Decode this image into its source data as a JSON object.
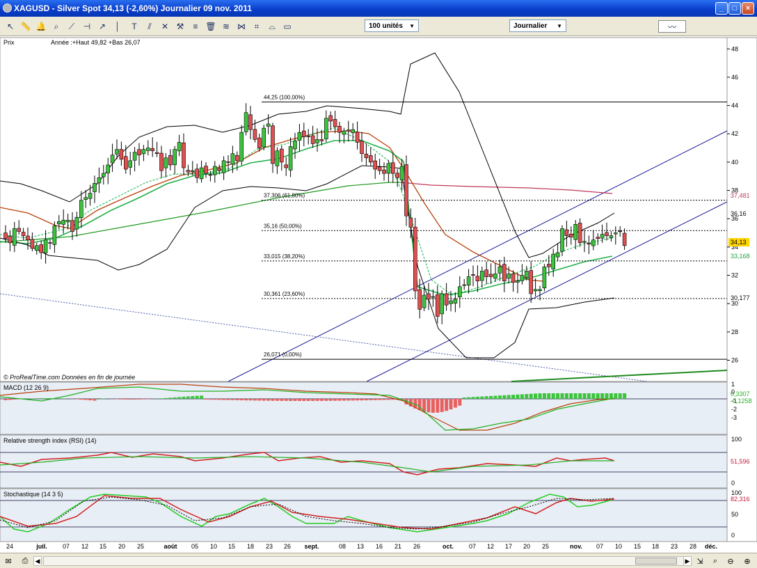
{
  "window": {
    "title": "XAGUSD - Silver Spot     34,13 (-2,60%)     Journalier  09 nov. 2011",
    "minimize_label": "_",
    "maximize_label": "□",
    "close_label": "×"
  },
  "toolbar": {
    "units_select": "100 unités",
    "period_select": "Journalier"
  },
  "panels": {
    "price": {
      "label": "Prix",
      "info": "Année :+Haut 49,82 +Bas 26,07",
      "footer": "© ProRealTime.com  Données en fin de journée",
      "fib_labels": [
        "44,25 (100,00%)",
        "37,306 (61,80%)",
        "35,16 (50,00%)",
        "33,015 (38,20%)",
        "30,361 (23,60%)",
        "26,071 (0,00%)"
      ],
      "last_price": "34,13",
      "value_tags": [
        "37,481",
        "36,16",
        "33,168",
        "30,177"
      ]
    },
    "macd": {
      "label": "MACD (12 26 9)",
      "value_tags": [
        "0,3307",
        "-0,1258"
      ]
    },
    "rsi": {
      "label": "Relative strength index (RSI) (14)",
      "value_tag": "51,596"
    },
    "stoch": {
      "label": "Stochastique (14 3 5)",
      "value_tag": "82,316"
    }
  },
  "colors": {
    "bull": "#3cc43c",
    "bear": "#e05050",
    "sma_long": "#1e9a1e",
    "sma_red": "#c0385a",
    "ema_mid": "#b8400a",
    "boll": "#000000",
    "channel": "#1a1a9a",
    "fib_line": "#000000",
    "panel_bg": "#ffffff"
  },
  "chart_data": [
    {
      "type": "candlestick",
      "title": "XAGUSD - Silver Spot",
      "ylim": [
        24.5,
        48.8
      ],
      "yticks": [
        26,
        28,
        30,
        32,
        34,
        36,
        38,
        40,
        42,
        44,
        46,
        48
      ],
      "x_tick_labels": [
        "24",
        "juil.",
        "07",
        "12",
        "15",
        "20",
        "25",
        "août",
        "05",
        "10",
        "15",
        "18",
        "23",
        "26",
        "sept.",
        "08",
        "13",
        "16",
        "21",
        "26",
        "oct.",
        "07",
        "12",
        "17",
        "20",
        "25",
        "nov.",
        "07",
        "10",
        "15",
        "18",
        "23",
        "28",
        "déc."
      ],
      "fibonacci": [
        {
          "label": "100,00%",
          "value": 44.25
        },
        {
          "label": "61,80%",
          "value": 37.306
        },
        {
          "label": "50,00%",
          "value": 35.16
        },
        {
          "label": "38,20%",
          "value": 33.015
        },
        {
          "label": "23,60%",
          "value": 30.361
        },
        {
          "label": "0,00%",
          "value": 26.071
        }
      ],
      "last_close": 34.13,
      "close_series": [
        34.6,
        34.3,
        35.3,
        35.1,
        34.8,
        34.5,
        33.9,
        34.1,
        33.6,
        34.5,
        34.3,
        35.5,
        35.8,
        35.9,
        35.9,
        35.1,
        36.1,
        37.3,
        37.5,
        37.8,
        38.5,
        38.9,
        39.2,
        39.8,
        40.5,
        40.9,
        40.2,
        39.5,
        40.1,
        40.7,
        40.5,
        40.9,
        41.0,
        40.8,
        40.6,
        39.4,
        40.3,
        39.8,
        40.9,
        41.4,
        39.6,
        39.3,
        39.4,
        38.9,
        39.6,
        39.2,
        39.1,
        39.7,
        39.4,
        40.1,
        40.0,
        40.6,
        40.1,
        42.1,
        43.5,
        42.3,
        41.6,
        41.0,
        42.4,
        42.7,
        39.9,
        40.8,
        40.0,
        39.6,
        41.1,
        41.5,
        42.1,
        41.8,
        41.8,
        41.3,
        41.6,
        41.5,
        43.1,
        42.9,
        42.5,
        42.1,
        42.2,
        42.2,
        42.3,
        41.4,
        40.6,
        40.3,
        40.0,
        39.5,
        39.4,
        39.2,
        39.9,
        39.2,
        38.9,
        39.7,
        36.2,
        35.4,
        30.9,
        29.6,
        30.6,
        30.3,
        30.5,
        29.1,
        30.7,
        29.9,
        30.2,
        30.3,
        31.2,
        31.3,
        31.9,
        32.0,
        31.6,
        32.3,
        31.9,
        31.9,
        32.1,
        32.6,
        31.6,
        32.1,
        31.5,
        31.6,
        32.0,
        32.3,
        30.7,
        31.0,
        31.0,
        32.6,
        32.6,
        33.5,
        33.6,
        35.3,
        34.8,
        34.7,
        35.6,
        34.3,
        34.4,
        34.2,
        34.5,
        34.6,
        34.9,
        34.8,
        34.8,
        35.0,
        35.1,
        34.1
      ],
      "indicators": [
        {
          "name": "MACD (12 26 9)",
          "last": [
            0.3307,
            -0.1258
          ],
          "ylim": [
            -3.1,
            1.6
          ]
        },
        {
          "name": "Relative strength index (RSI) (14)",
          "last": 51.596,
          "ylim": [
            0,
            100
          ],
          "levels": [
            30,
            70
          ]
        },
        {
          "name": "Stochastique (14 3 5)",
          "last": 82.316,
          "ylim": [
            0,
            100
          ],
          "levels": [
            20,
            80
          ]
        }
      ]
    }
  ]
}
